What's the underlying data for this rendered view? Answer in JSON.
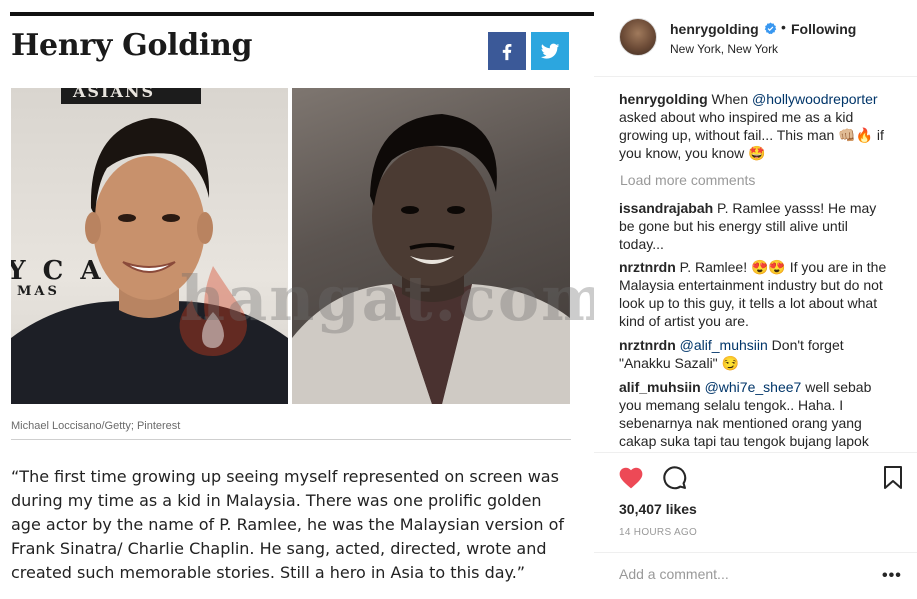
{
  "article": {
    "title": "Henry Golding",
    "share": {
      "facebook_icon": "facebook-icon",
      "twitter_icon": "twitter-icon"
    },
    "backdrop_top": "ASIANS",
    "backdrop_mid": "Y C A",
    "backdrop_low": "MAS",
    "photo_caption": "Michael Loccisano/Getty; Pinterest",
    "quote": "“The first time growing up seeing myself represented on screen was during my time as a kid in Malaysia. There was one prolific golden age actor by the name of P. Ramlee, he was the Malaysian version of Frank Sinatra/ Charlie Chaplin. He sang, acted, directed, wrote and created such memorable stories. Still a hero in Asia to this day.”",
    "watermark": "hangat.com"
  },
  "post": {
    "username": "henrygolding",
    "following_label": "Following",
    "separator": "•",
    "location": "New York, New York",
    "caption": {
      "user": "henrygolding",
      "text_before": " When ",
      "mention": "@hollywoodreporter",
      "text_after": " asked about who inspired me as a kid growing up, without fail... This man 👊🏼🔥 if you know, you know 🤩"
    },
    "load_more": "Load more comments",
    "comments": [
      {
        "user": "issandrajabah",
        "text": " P. Ramlee yasss! He may be gone but his energy still alive until today..."
      },
      {
        "user": "nrztnrdn",
        "text": " P. Ramlee! 😍😍 If you are in the Malaysia entertainment industry but do not look up to this guy, it tells a lot about what kind of artist you are."
      },
      {
        "user": "nrztnrdn",
        "mention": "@alif_muhsiin",
        "text": " Don't forget \"Anakku Sazali\" 😏"
      },
      {
        "user": "alif_muhsiin",
        "mention": "@whi7e_shee7",
        "text": " well sebab you memang selalu tengok.. Haha. I sebenarnya nak mentioned orang yang cakap suka tapi tau tengok bujang lapok"
      }
    ],
    "likes": "30,407 likes",
    "time": "14 HOURS AGO",
    "add_comment_placeholder": "Add a comment...",
    "more_label": "•••",
    "icons": {
      "like": "heart-icon",
      "comment": "comment-bubble-icon",
      "save": "bookmark-icon",
      "verified": "verified-badge-icon"
    },
    "colors": {
      "like": "#ed4956",
      "verified": "#3897f0",
      "mention": "#003569",
      "muted": "#999999"
    }
  }
}
